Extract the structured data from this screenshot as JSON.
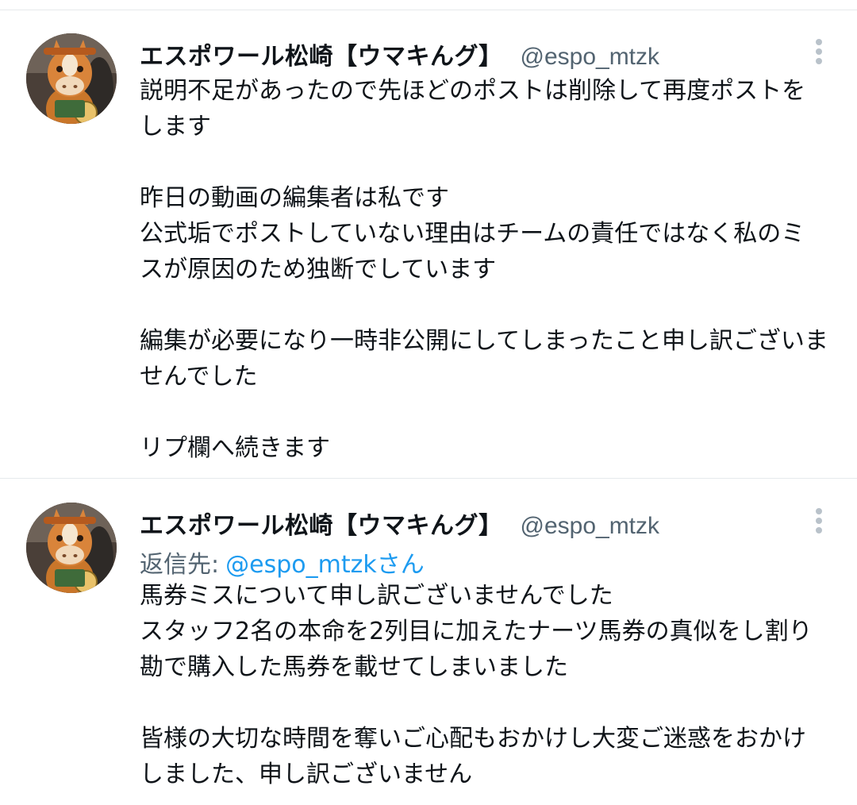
{
  "posts": [
    {
      "display_name": "エスポワール松崎【ウマキんグ】",
      "handle": "@espo_mtzk",
      "avatar": "horse-mascot-avatar",
      "text": "説明不足があったので先ほどのポストは削除して再度ポストをします\n\n昨日の動画の編集者は私です\n公式垢でポストしていない理由はチームの責任ではなく私のミスが原因のため独断でしています\n\n編集が必要になり一時非公開にしてしまったこと申し訳ございませんでした\n\nリプ欄へ続きます"
    },
    {
      "display_name": "エスポワール松崎【ウマキんグ】",
      "handle": "@espo_mtzk",
      "avatar": "horse-mascot-avatar",
      "reply_to_label": "返信先:",
      "reply_to_mention": "@espo_mtzkさん",
      "text": "馬券ミスについて申し訳ございませんでした\nスタッフ2名の本命を2列目に加えたナーツ馬券の真似をし割り勘で購入した馬券を載せてしまいました\n\n皆様の大切な時間を奪いご心配もおかけし大変ご迷惑をおかけしました、申し訳ございません"
    }
  ],
  "colors": {
    "text": "#0f1419",
    "secondary": "#536471",
    "mention": "#1d9bf0",
    "divider": "#e6e9ec"
  },
  "icons": {
    "more": "more-vertical-icon"
  }
}
